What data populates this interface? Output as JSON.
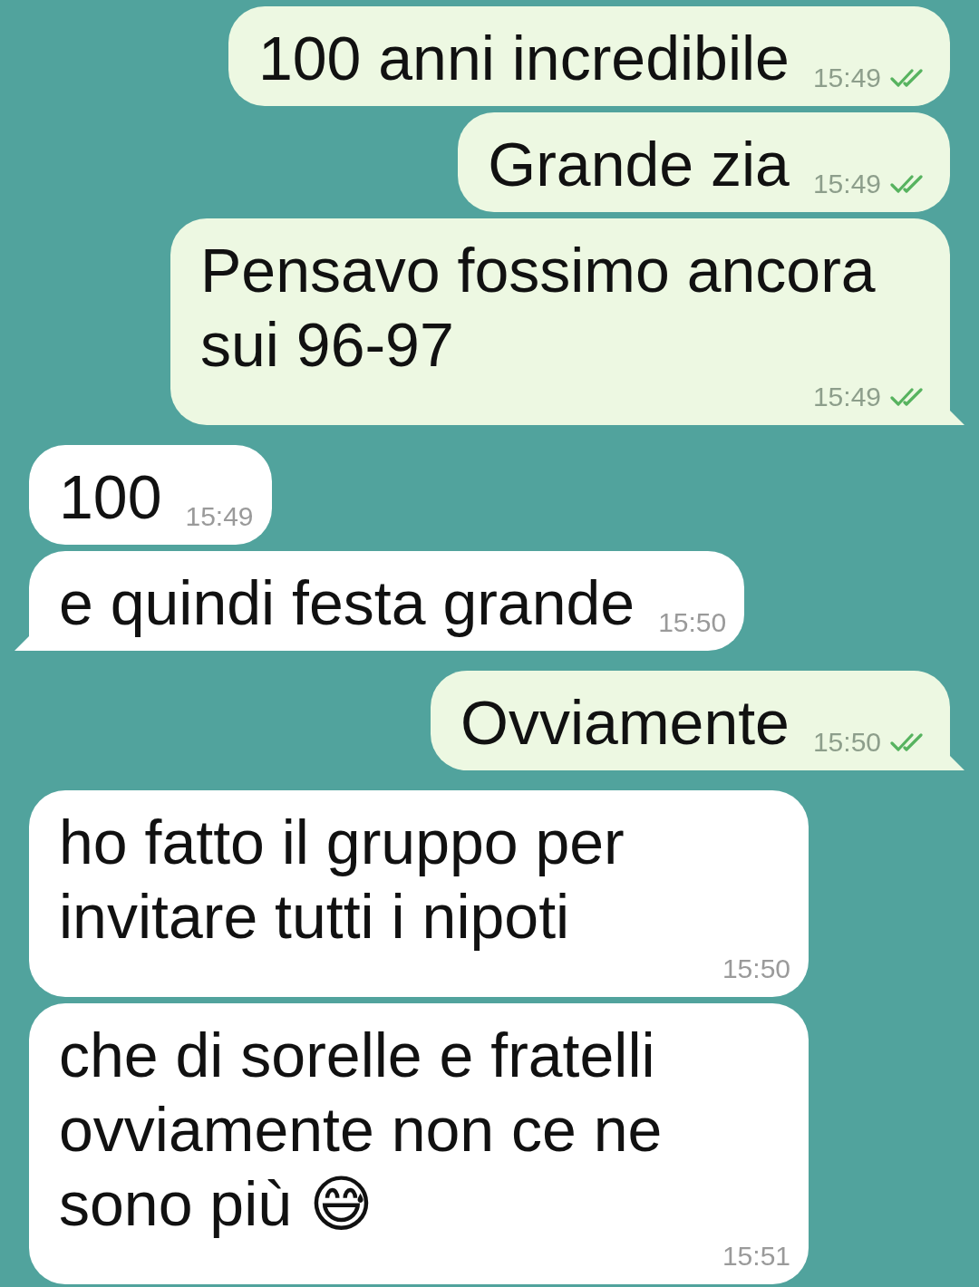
{
  "messages": [
    {
      "outgoing": true,
      "text": "100 anni incredibile",
      "time": "15:49",
      "read": true,
      "tail": false
    },
    {
      "outgoing": true,
      "text": "Grande zia",
      "time": "15:49",
      "read": true,
      "tail": false
    },
    {
      "outgoing": true,
      "text": "Pensavo fossimo ancora sui 96-97",
      "time": "15:49",
      "read": true,
      "tail": true
    },
    {
      "outgoing": false,
      "text": "100",
      "time": "15:49",
      "tail": false
    },
    {
      "outgoing": false,
      "text": "e quindi festa grande",
      "time": "15:50",
      "tail": true
    },
    {
      "outgoing": true,
      "text": "Ovviamente",
      "time": "15:50",
      "read": true,
      "tail": true
    },
    {
      "outgoing": false,
      "text": "ho fatto il gruppo per invitare tutti i nipoti",
      "time": "15:50",
      "tail": false
    },
    {
      "outgoing": false,
      "text": "che di sorelle e fratelli ovviamente non ce ne sono più 😅",
      "time": "15:51",
      "tail": false
    }
  ]
}
